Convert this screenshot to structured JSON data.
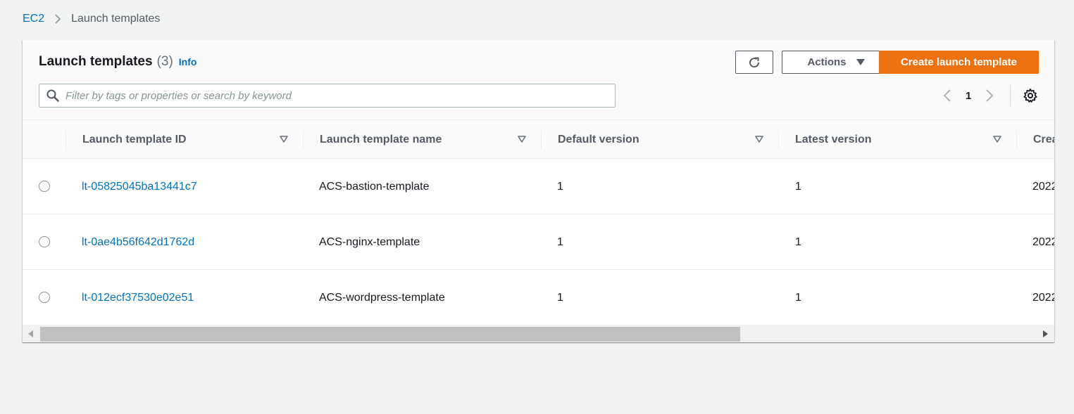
{
  "breadcrumb": {
    "root": "EC2",
    "current": "Launch templates"
  },
  "header": {
    "title": "Launch templates",
    "count": "(3)",
    "info": "Info",
    "actions_label": "Actions",
    "create_label": "Create launch template",
    "refresh_icon": "refresh-icon",
    "settings_icon": "gear-icon"
  },
  "search": {
    "placeholder": "Filter by tags or properties or search by keyword",
    "value": ""
  },
  "pagination": {
    "page": "1"
  },
  "table": {
    "columns": [
      "Launch template ID",
      "Launch template name",
      "Default version",
      "Latest version",
      "Crea"
    ],
    "rows": [
      {
        "id": "lt-05825045ba13441c7",
        "name": "ACS-bastion-template",
        "default": "1",
        "latest": "1",
        "created": "2022"
      },
      {
        "id": "lt-0ae4b56f642d1762d",
        "name": "ACS-nginx-template",
        "default": "1",
        "latest": "1",
        "created": "2022"
      },
      {
        "id": "lt-012ecf37530e02e51",
        "name": "ACS-wordpress-template",
        "default": "1",
        "latest": "1",
        "created": "2022"
      }
    ]
  },
  "colors": {
    "primary": "#ec7211",
    "link": "#0073bb",
    "background": "#f2f3f3"
  }
}
